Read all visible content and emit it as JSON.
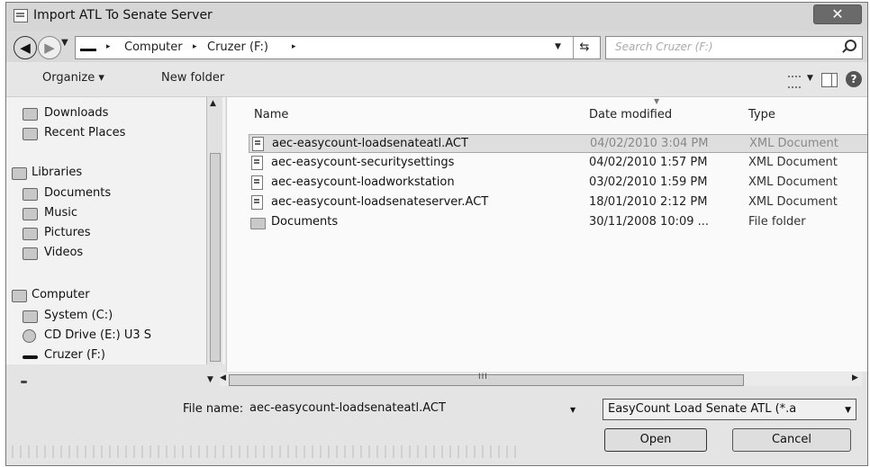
{
  "window": {
    "title": "Import ATL To Senate Server",
    "close_label": "✕"
  },
  "nav": {
    "back_label": "◀",
    "forward_label": "▶",
    "recent_drop": "▼",
    "refresh_label": "⇆"
  },
  "address": {
    "crumbs": [
      "Computer",
      "Cruzer (F:)"
    ],
    "separator": "▸"
  },
  "search": {
    "placeholder": "Search Cruzer (F:)"
  },
  "toolbar": {
    "organize_label": "Organize ▾",
    "new_folder_label": "New folder",
    "help_label": "?"
  },
  "sidebar": {
    "items": [
      {
        "label": "Downloads"
      },
      {
        "label": "Recent Places"
      },
      {
        "label": "Libraries"
      },
      {
        "label": "Documents"
      },
      {
        "label": "Music"
      },
      {
        "label": "Pictures"
      },
      {
        "label": "Videos"
      },
      {
        "label": "Computer"
      },
      {
        "label": "System (C:)"
      },
      {
        "label": "CD Drive (E:) U3 S"
      },
      {
        "label": "Cruzer (F:)"
      }
    ]
  },
  "columns": {
    "name": "Name",
    "date": "Date modified",
    "type": "Type"
  },
  "files": [
    {
      "name": "aec-easycount-loadsenateatl.ACT",
      "date": "04/02/2010 3:04 PM",
      "type": "XML Document",
      "selected": true
    },
    {
      "name": "aec-easycount-securitysettings",
      "date": "04/02/2010 1:57 PM",
      "type": "XML Document"
    },
    {
      "name": "aec-easycount-loadworkstation",
      "date": "03/02/2010 1:59 PM",
      "type": "XML Document"
    },
    {
      "name": "aec-easycount-loadsenateserver.ACT",
      "date": "18/01/2010 2:12 PM",
      "type": "XML Document"
    },
    {
      "name": "Documents",
      "date": "30/11/2008 10:09 ...",
      "type": "File folder"
    }
  ],
  "scroll": {
    "left": "◀",
    "right": "▶",
    "up": "▲",
    "down": "▼",
    "grip": "III"
  },
  "bottom": {
    "file_name_label": "File name:",
    "file_name_value": "aec-easycount-loadsenateatl.ACT",
    "filter_value": "EasyCount Load Senate ATL (*.a",
    "open_label": "Open",
    "cancel_label": "Cancel"
  }
}
